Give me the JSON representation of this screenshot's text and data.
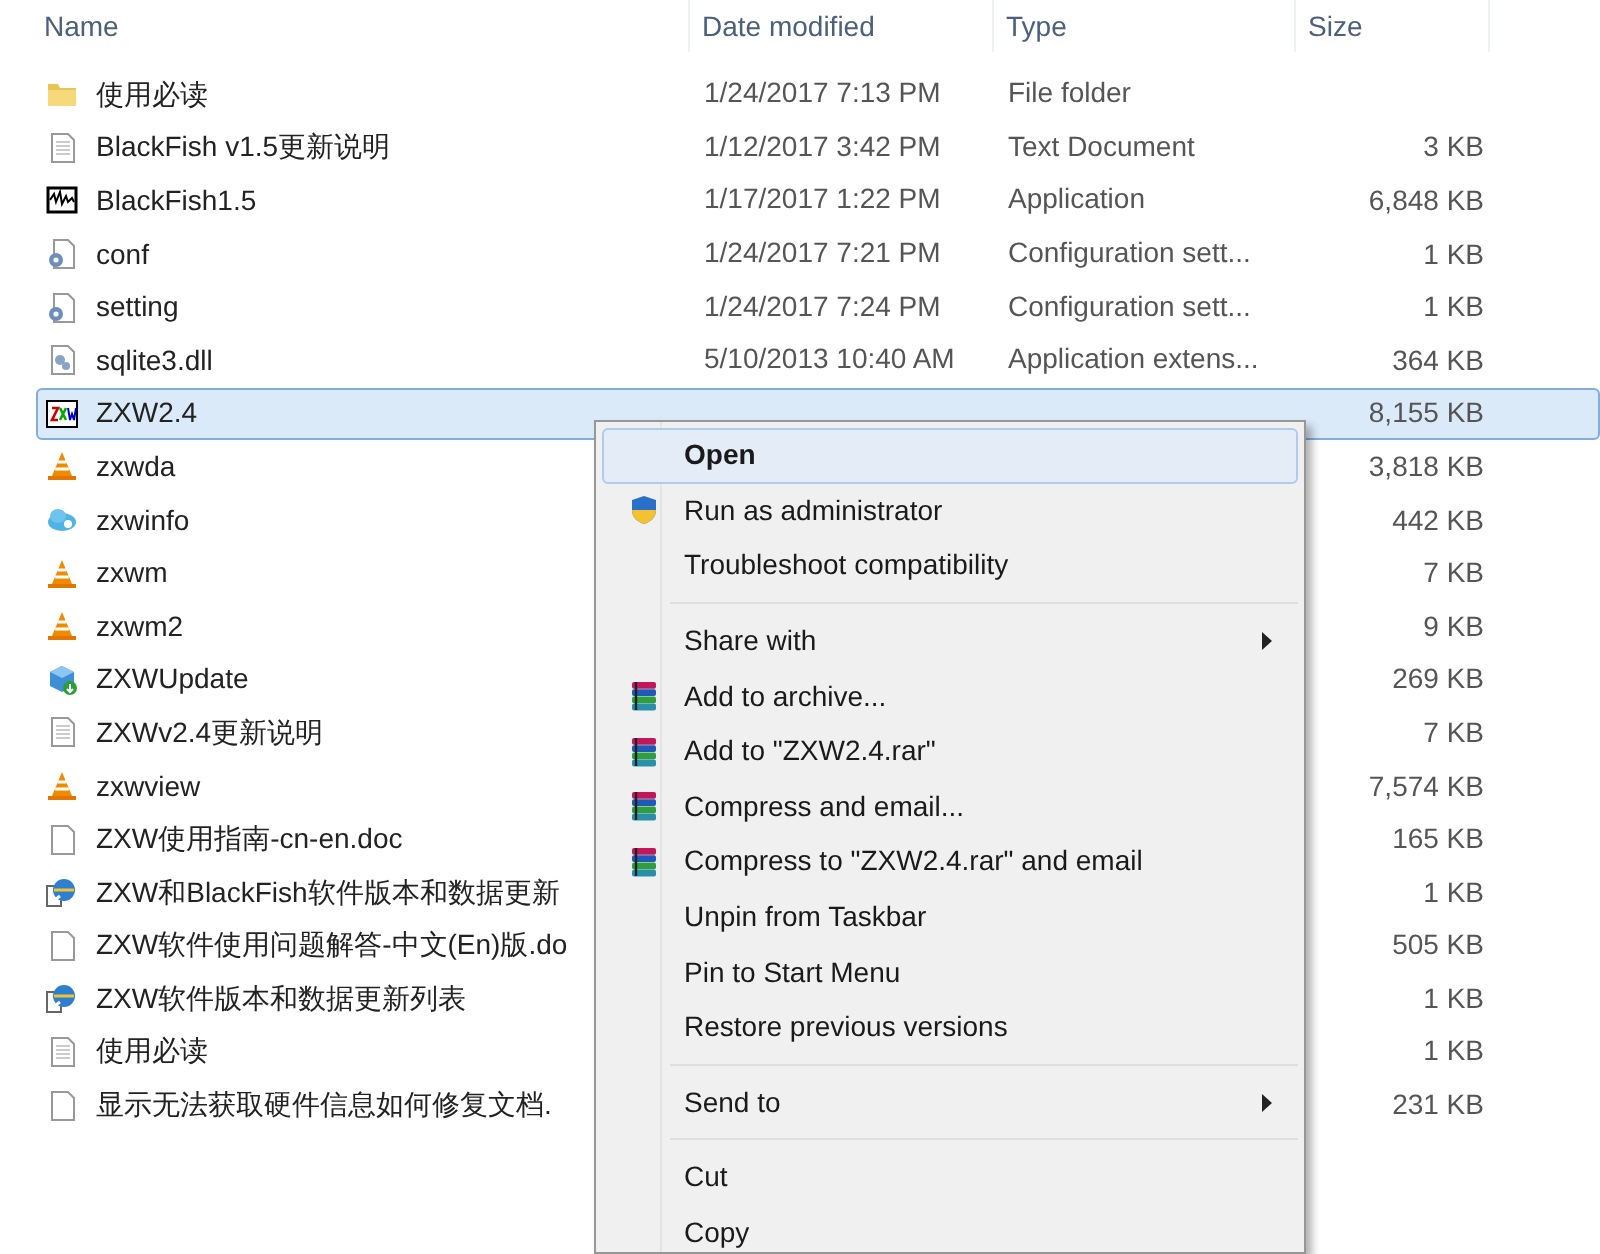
{
  "columns": [
    {
      "label": "Name"
    },
    {
      "label": "Date modified"
    },
    {
      "label": "Type"
    },
    {
      "label": "Size"
    }
  ],
  "rows": [
    {
      "kind": "folder",
      "name": "使用必读",
      "date": "1/24/2017 7:13 PM",
      "type": "File folder",
      "selected": false
    },
    {
      "kind": "text",
      "name": "BlackFish v1.5更新说明",
      "date": "1/12/2017 3:42 PM",
      "type": "Text Document",
      "size": "3 KB",
      "selected": false
    },
    {
      "kind": "wave",
      "name": "BlackFish1.5",
      "date": "1/17/2017 1:22 PM",
      "type": "Application",
      "size": "6,848 KB",
      "selected": false
    },
    {
      "kind": "config",
      "name": "conf",
      "date": "1/24/2017 7:21 PM",
      "type": "Configuration sett...",
      "size": "1 KB",
      "selected": false
    },
    {
      "kind": "config",
      "name": "setting",
      "date": "1/24/2017 7:24 PM",
      "type": "Configuration sett...",
      "size": "1 KB",
      "selected": false
    },
    {
      "kind": "dll",
      "name": "sqlite3.dll",
      "date": "5/10/2013 10:40 AM",
      "type": "Application extens...",
      "size": "364 KB",
      "selected": false
    },
    {
      "kind": "zxw",
      "name": "ZXW2.4",
      "size": "8,155 KB",
      "selected": true
    },
    {
      "kind": "cone",
      "name": "zxwda",
      "size": "3,818 KB",
      "selected": false
    },
    {
      "kind": "cloud",
      "name": "zxwinfo",
      "size": "442 KB",
      "selected": false
    },
    {
      "kind": "cone",
      "name": "zxwm",
      "size": "7 KB",
      "selected": false
    },
    {
      "kind": "cone",
      "name": "zxwm2",
      "size": "9 KB",
      "selected": false
    },
    {
      "kind": "update",
      "name": "ZXWUpdate",
      "size": "269 KB",
      "selected": false
    },
    {
      "kind": "text",
      "name": "ZXWv2.4更新说明",
      "size": "7 KB",
      "selected": false
    },
    {
      "kind": "cone",
      "name": "zxwview",
      "size": "7,574 KB",
      "selected": false
    },
    {
      "kind": "blank",
      "name": "ZXW使用指南-cn-en.doc",
      "size": "165 KB",
      "selected": false
    },
    {
      "kind": "ie",
      "name": "ZXW和BlackFish软件版本和数据更新",
      "size": "1 KB",
      "selected": false
    },
    {
      "kind": "blank",
      "name": "ZXW软件使用问题解答-中文(En)版.do",
      "size": "505 KB",
      "selected": false
    },
    {
      "kind": "ie",
      "name": "ZXW软件版本和数据更新列表",
      "size": "1 KB",
      "selected": false
    },
    {
      "kind": "text",
      "name": "使用必读",
      "size": "1 KB",
      "selected": false
    },
    {
      "kind": "blank",
      "name": "显示无法获取硬件信息如何修复文档.",
      "size": "231 KB",
      "selected": false
    }
  ],
  "context_menu": {
    "groups": [
      [
        {
          "label": "Open",
          "default": true,
          "selected": true
        },
        {
          "label": "Run as administrator",
          "kind": "shield",
          "selected": false
        },
        {
          "label": "Troubleshoot compatibility",
          "selected": false
        }
      ],
      [
        {
          "label": "Share with",
          "submenu": true,
          "selected": false
        },
        {
          "label": "Add to archive...",
          "kind": "rar",
          "selected": false
        },
        {
          "label": "Add to \"ZXW2.4.rar\"",
          "kind": "rar",
          "selected": false
        },
        {
          "label": "Compress and email...",
          "kind": "rar",
          "selected": false
        },
        {
          "label": "Compress to \"ZXW2.4.rar\" and email",
          "kind": "rar",
          "selected": false
        },
        {
          "label": "Unpin from Taskbar",
          "selected": false
        },
        {
          "label": "Pin to Start Menu",
          "selected": false
        },
        {
          "label": "Restore previous versions",
          "selected": false
        }
      ],
      [
        {
          "label": "Send to",
          "submenu": true,
          "selected": false
        }
      ],
      [
        {
          "label": "Cut",
          "selected": false
        },
        {
          "label": "Copy",
          "selected": false
        }
      ]
    ]
  }
}
